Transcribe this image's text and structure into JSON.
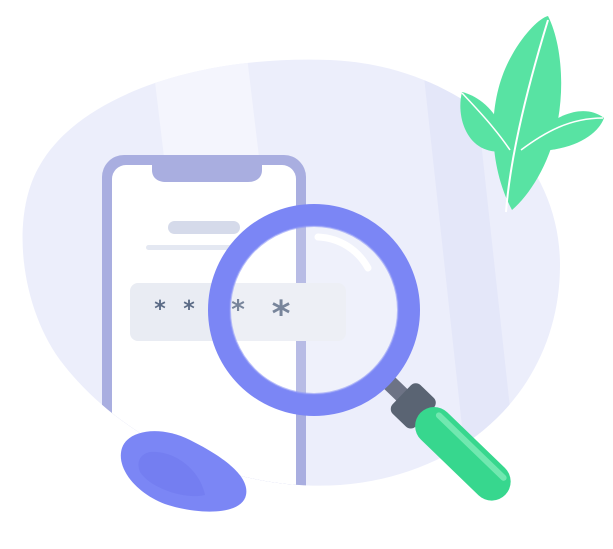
{
  "illustration": {
    "password_masks": [
      "*",
      "*",
      "*",
      "*"
    ],
    "colors": {
      "blob": "#eceefb",
      "phone_frame": "#a9aee0",
      "phone_screen": "#ffffff",
      "placeholder_bar": "#d5daea",
      "password_field": "#e9ecf3",
      "mask_glyph": "#5b6b86",
      "magnifier_ring": "#7b86f5",
      "magnifier_handle": "#37d78e",
      "handle_collar": "#5a6473",
      "leaf": "#58e3a3",
      "pebble": "#7b86f5"
    },
    "icons": [
      "leaf-icon",
      "magnifying-glass-icon",
      "pebble-icon",
      "smartphone-icon"
    ]
  }
}
